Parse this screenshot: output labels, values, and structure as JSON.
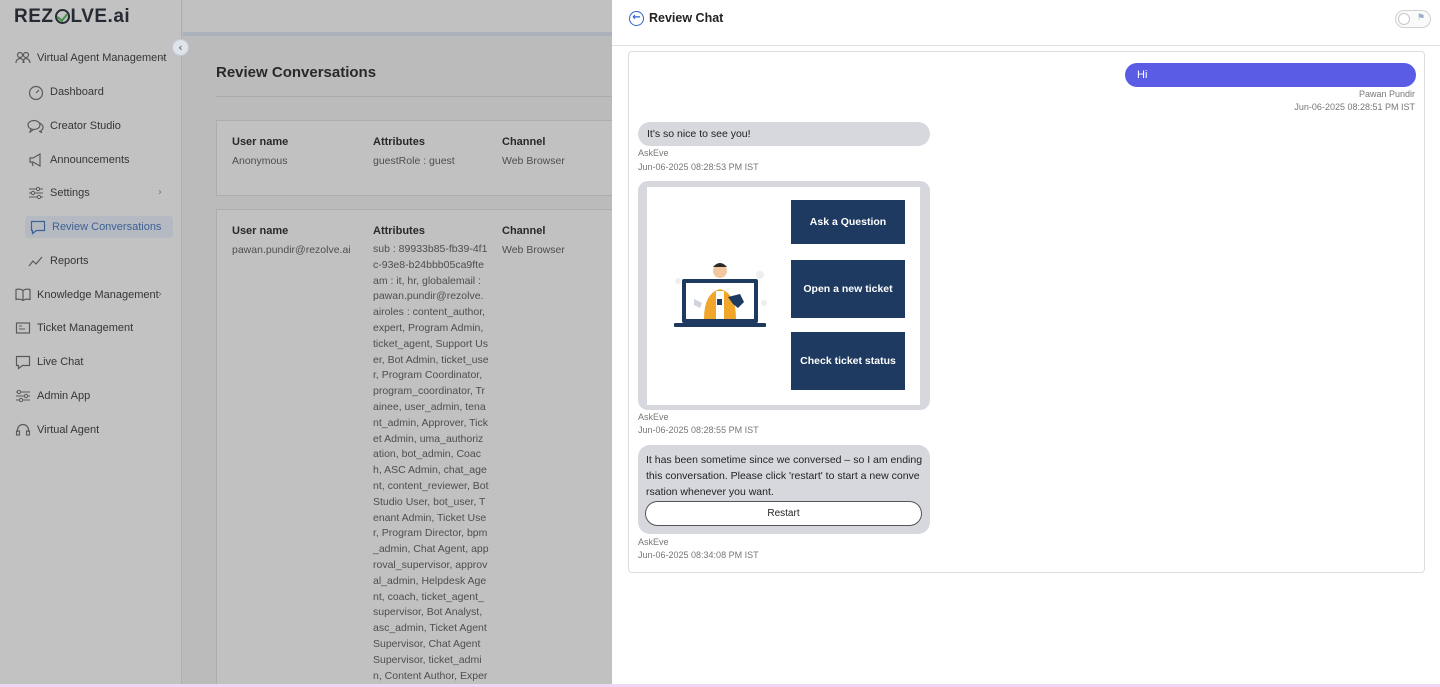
{
  "sidebar": {
    "logo": {
      "pre": "REZ",
      "post": "LVE.ai"
    },
    "items": [
      {
        "label": "Virtual Agent Management",
        "icon": "users-gear-icon"
      },
      {
        "label": "Dashboard",
        "icon": "gauge-icon"
      },
      {
        "label": "Creator Studio",
        "icon": "chat-bubbles-icon"
      },
      {
        "label": "Announcements",
        "icon": "megaphone-icon"
      },
      {
        "label": "Settings",
        "icon": "sliders-icon"
      },
      {
        "label": "Review Conversations",
        "icon": "chat-review-icon"
      },
      {
        "label": "Reports",
        "icon": "trend-line-icon"
      },
      {
        "label": "Knowledge Management",
        "icon": "book-icon"
      },
      {
        "label": "Ticket Management",
        "icon": "ticket-icon"
      },
      {
        "label": "Live Chat",
        "icon": "chat-icon"
      },
      {
        "label": "Admin App",
        "icon": "admin-sliders-icon"
      },
      {
        "label": "Virtual Agent",
        "icon": "headset-icon"
      }
    ]
  },
  "main": {
    "title": "Review Conversations",
    "columns": {
      "user": "User name",
      "attributes": "Attributes",
      "channel": "Channel"
    },
    "rows": [
      {
        "user": "Anonymous",
        "attributes": "guestRole : guest",
        "channel": "Web Browser"
      },
      {
        "user": "pawan.pundir@rezolve.ai",
        "attributes": "sub : 89933b85-fb39-4f1c-93e8-b24bbb05ca9fteam : it, hr, globalemail : pawan.pundir@rezolve.airoles : content_author, expert, Program Admin, ticket_agent, Support User, Bot Admin, ticket_user, Program Coordinator, program_coordinator, Trainee, user_admin, tenant_admin, Approver, Ticket Admin, uma_authorization, bot_admin, Coach, ASC Admin, chat_agent, content_reviewer, BotStudio User, bot_user, Tenant Admin, Ticket User, Program Director, bpm_admin, Chat Agent, approval_supervisor, approval_admin, Helpdesk Agent, coach, ticket_agent_supervisor, Bot Analyst, asc_admin, Ticket Agent Supervisor, Chat Agent Supervisor, ticket_admin, Content Author, Expert, aidochub, support_",
        "channel": "Web Browser"
      }
    ]
  },
  "panel": {
    "title": "Review Chat",
    "messages": {
      "user_msg": {
        "text": "Hi",
        "sender": "Pawan Pundir",
        "time": "Jun-06-2025 08:28:51 PM IST"
      },
      "bot_msg1": {
        "text": "It's so nice to see you!",
        "sender": "AskEve",
        "time": "Jun-06-2025 08:28:53 PM IST"
      },
      "bot_menu": {
        "buttons": [
          "Ask a Question",
          "Open a new ticket",
          "Check ticket status"
        ],
        "sender": "AskEve",
        "time": "Jun-06-2025 08:28:55 PM IST"
      },
      "bot_msg2": {
        "text": "It has been sometime since we conversed – so I am ending this conversation. Please click 'restart' to start a new conversation whenever you want.",
        "button": "Restart",
        "sender": "AskEve",
        "time": "Jun-06-2025 08:34:08 PM IST"
      }
    }
  }
}
